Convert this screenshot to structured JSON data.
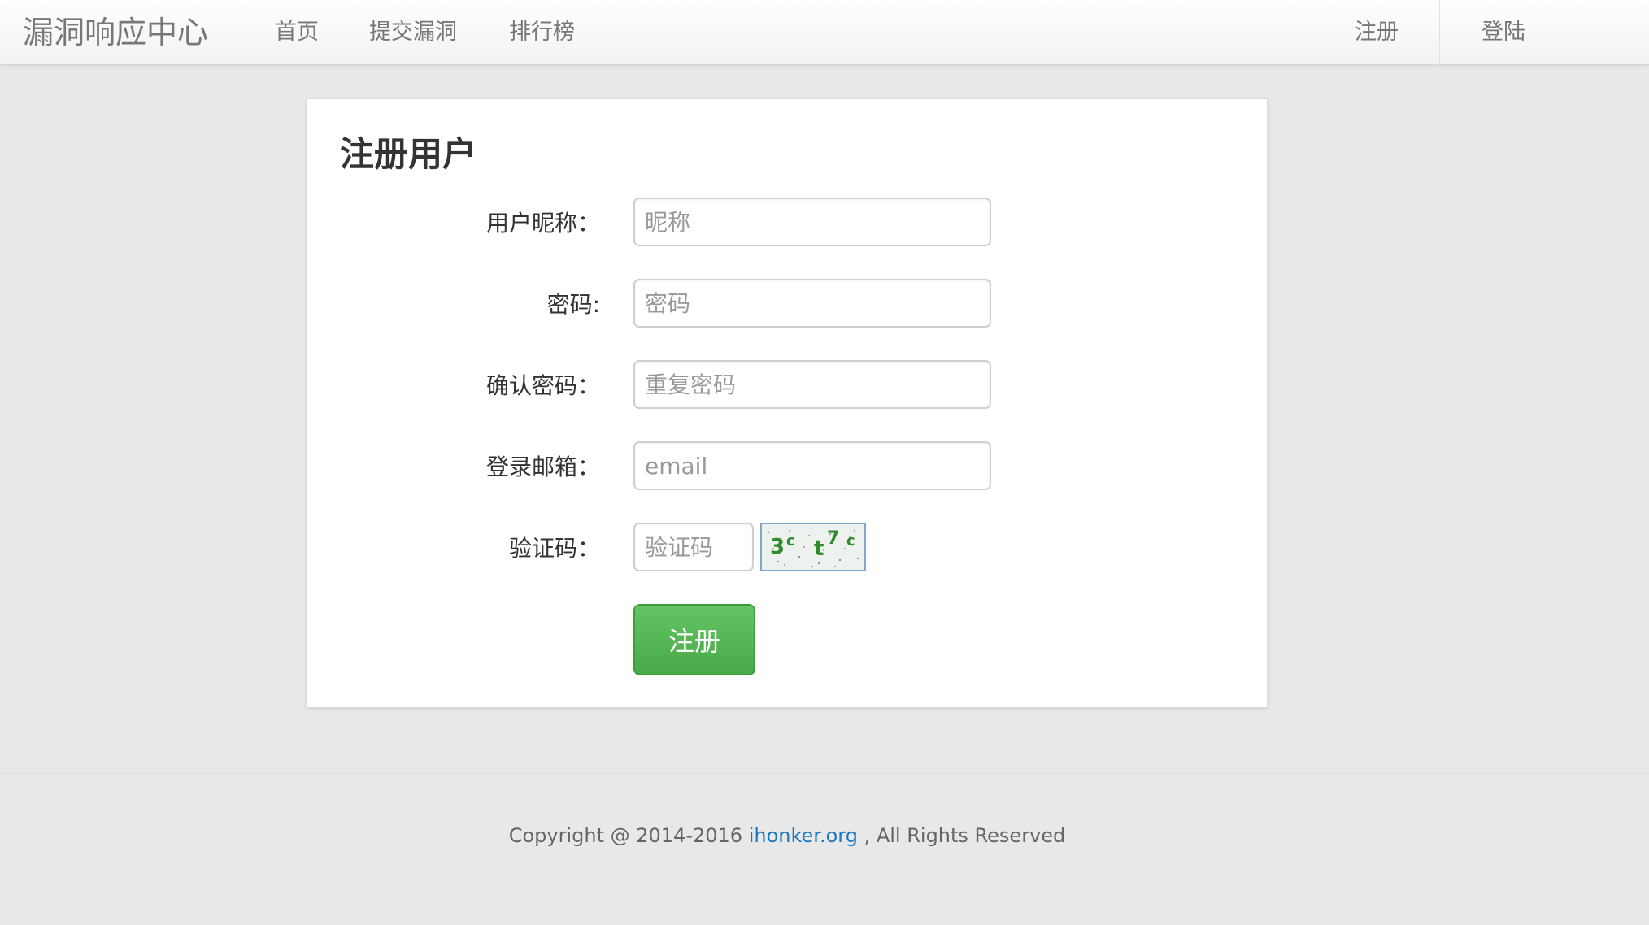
{
  "navbar": {
    "brand": "漏洞响应中心",
    "links": [
      "首页",
      "提交漏洞",
      "排行榜"
    ],
    "register": "注册",
    "login": "登陆"
  },
  "form": {
    "title": "注册用户",
    "nickname": {
      "label": "用户昵称：",
      "placeholder": "昵称"
    },
    "password": {
      "label": "密码:",
      "placeholder": "密码"
    },
    "confirm": {
      "label": "确认密码：",
      "placeholder": "重复密码"
    },
    "email": {
      "label": "登录邮箱：",
      "placeholder": "email"
    },
    "captcha": {
      "label": "验证码：",
      "placeholder": "验证码",
      "image_text": "3c t7c"
    },
    "submit_label": "注册",
    "submit_color": "#5cb85c"
  },
  "footer": {
    "prefix": "Copyright @ 2014-2016 ",
    "link": "ihonker.org",
    "suffix": " , All Rights Reserved",
    "link_color": "#1a78c2"
  }
}
